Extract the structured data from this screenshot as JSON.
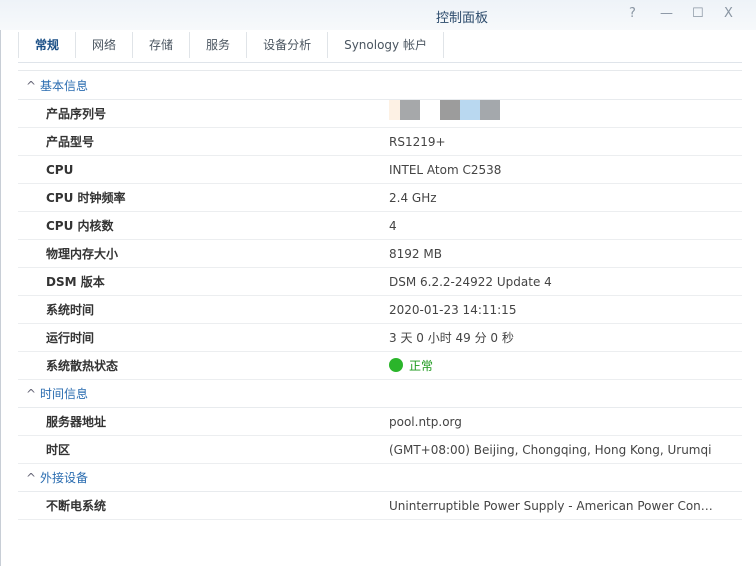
{
  "window": {
    "title": "控制面板",
    "help": "?",
    "minimize": "—",
    "maximize": "☐",
    "close": "X"
  },
  "tabs": [
    "常规",
    "网络",
    "存储",
    "服务",
    "设备分析",
    "Synology 帐户"
  ],
  "sections": [
    {
      "title": "基本信息",
      "rows": [
        {
          "key": "产品序列号",
          "value": ""
        },
        {
          "key": "产品型号",
          "value": "RS1219+"
        },
        {
          "key": "CPU",
          "value": "INTEL Atom C2538"
        },
        {
          "key": "CPU 时钟频率",
          "value": "2.4 GHz"
        },
        {
          "key": "CPU 内核数",
          "value": "4"
        },
        {
          "key": "物理内存大小",
          "value": "8192 MB"
        },
        {
          "key": "DSM 版本",
          "value": "DSM 6.2.2-24922 Update 4"
        },
        {
          "key": "系统时间",
          "value": "2020-01-23 14:11:15"
        },
        {
          "key": "运行时间",
          "value": "3 天 0 小时 49 分 0 秒"
        },
        {
          "key": "系统散热状态",
          "value": "正常"
        }
      ]
    },
    {
      "title": "时间信息",
      "rows": [
        {
          "key": "服务器地址",
          "value": "pool.ntp.org"
        },
        {
          "key": "时区",
          "value": "(GMT+08:00) Beijing, Chongqing, Hong Kong, Urumqi"
        }
      ]
    },
    {
      "title": "外接设备",
      "rows": [
        {
          "key": "不断电系统",
          "value": "Uninterruptible Power Supply - American Power Conversion"
        }
      ]
    }
  ],
  "colors": {
    "accent": "#2a6cb0",
    "status_ok": "#2bb52b"
  }
}
